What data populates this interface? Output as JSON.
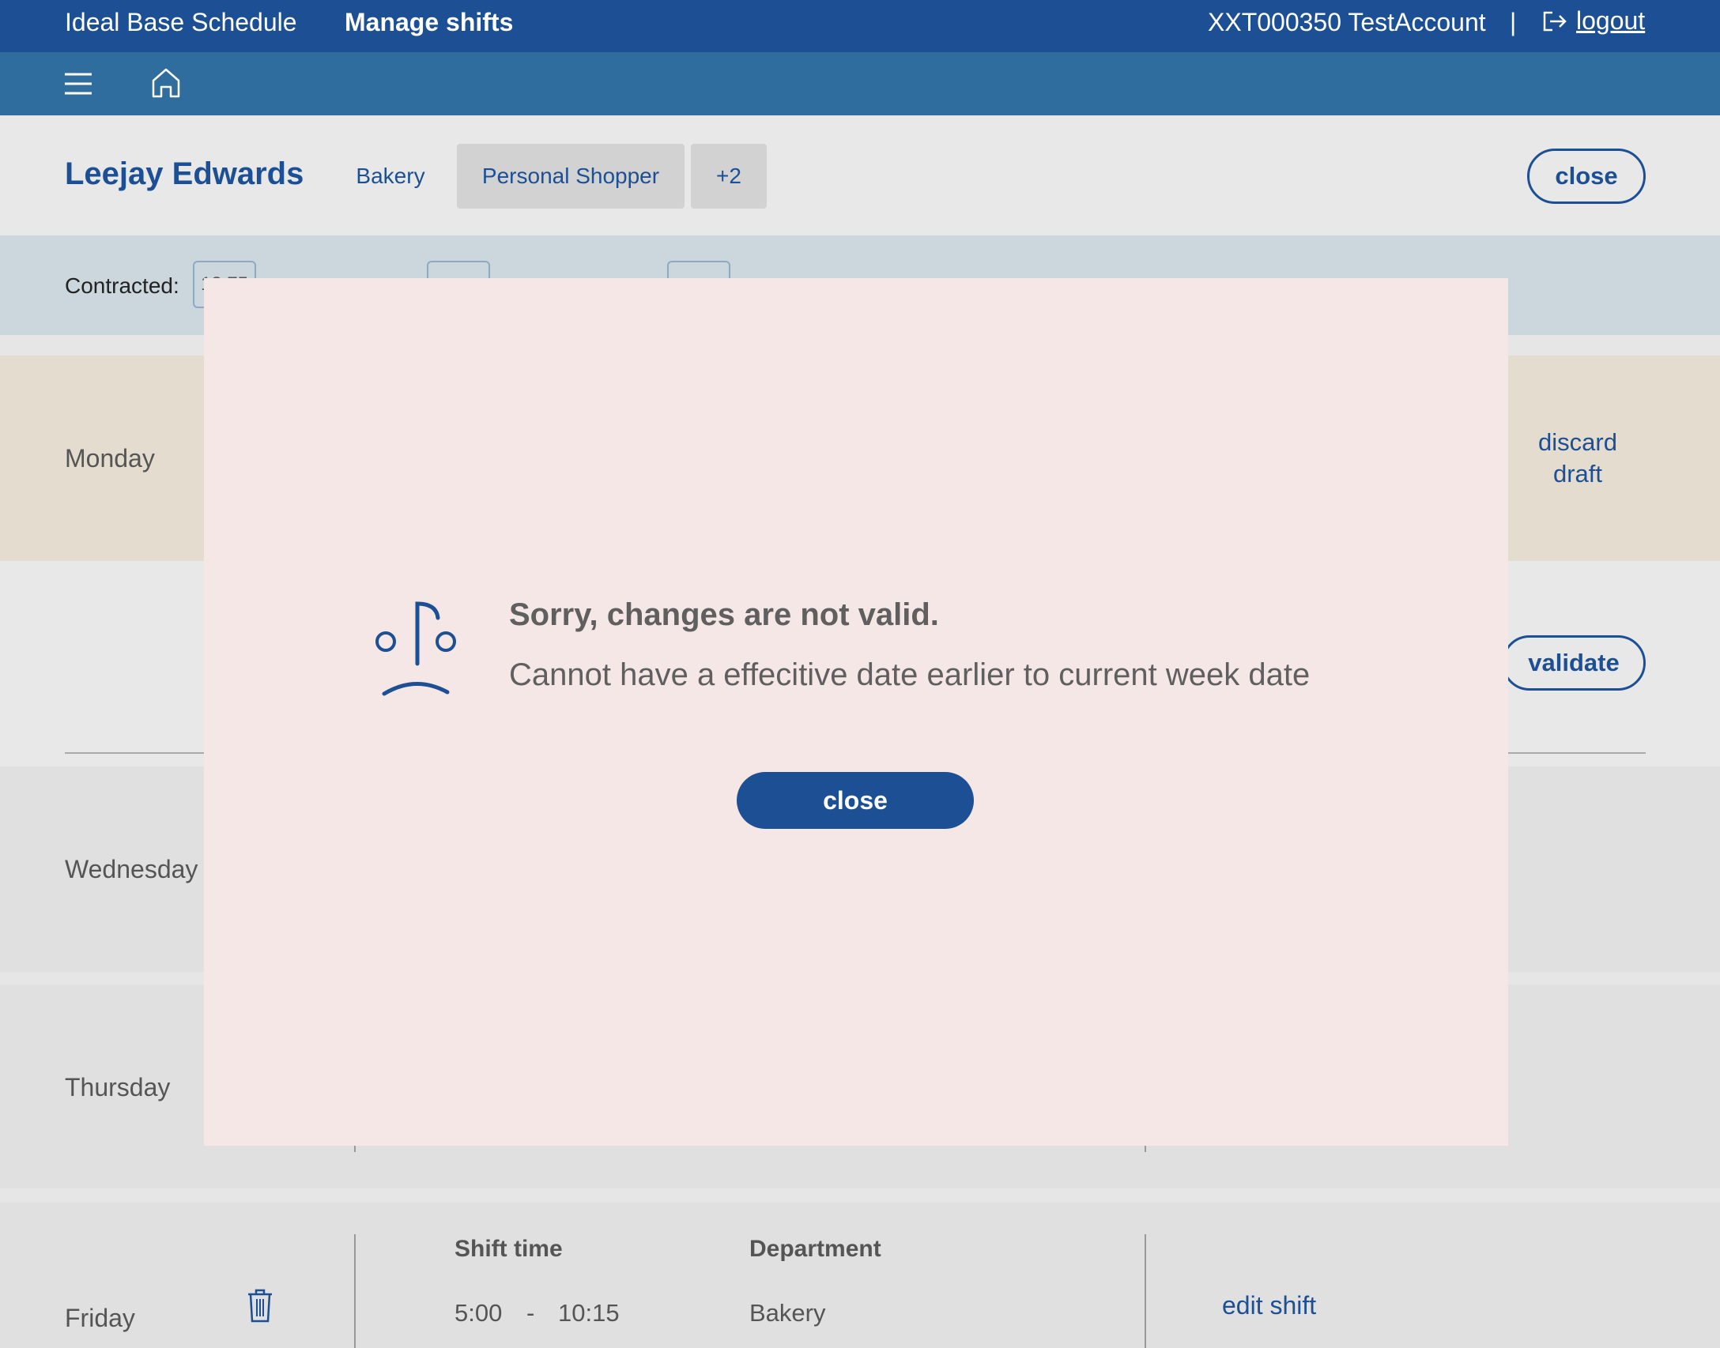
{
  "header": {
    "app_title": "Ideal Base Schedule",
    "page_title": "Manage shifts",
    "account": "XXT000350 TestAccount",
    "separator": "|",
    "logout_label": "logout"
  },
  "nav": {
    "menu_icon": "hamburger-menu-icon",
    "home_icon": "home-icon"
  },
  "employee": {
    "name": "Leejay Edwards",
    "tags": [
      "Bakery",
      "Personal Shopper",
      "+2"
    ],
    "close_label": "close"
  },
  "hours": {
    "contracted_label": "Contracted:",
    "contracted_value": "18.75"
  },
  "days": {
    "monday": "Monday",
    "wednesday": "Wednesday",
    "thursday": "Thursday",
    "friday": "Friday"
  },
  "actions": {
    "discard_draft": "discard draft",
    "validate": "validate"
  },
  "friday_shift": {
    "shift_time_header": "Shift time",
    "department_header": "Department",
    "start": "5:00",
    "dash": "-",
    "end": "10:15",
    "department": "Bakery",
    "edit_label": "edit shift"
  },
  "modal": {
    "title": "Sorry, changes are not valid.",
    "message": "Cannot have a effecitive date earlier to current week date",
    "close_label": "close",
    "icon": "sad-face-icon"
  },
  "colors": {
    "primary": "#1c4f93",
    "nav": "#2f6d9e",
    "modal_bg": "#f5e7e6",
    "draft_row": "#e3dccf"
  }
}
